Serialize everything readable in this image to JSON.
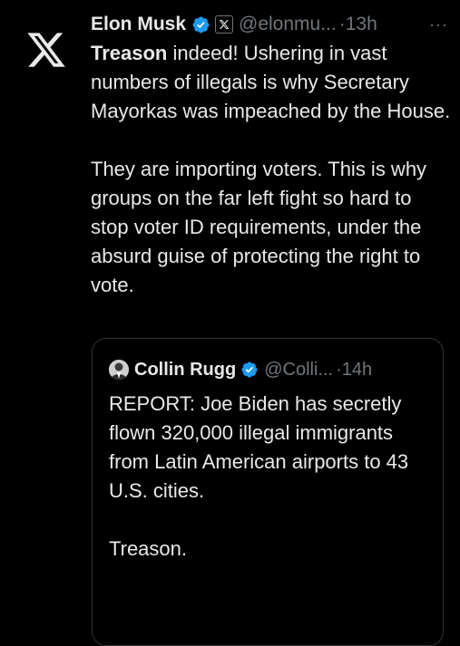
{
  "tweet": {
    "avatar_icon": "x-logo-icon",
    "author_name": "Elon Musk",
    "verified_icon": "verified-badge-icon",
    "affiliation_icon": "x-affiliate-icon",
    "handle": "@elonmu...",
    "separator": "·",
    "time": "13h",
    "more_icon": "more-options-icon",
    "more_label": "···",
    "text": {
      "bold_word": "Treason",
      "p1_rest": " indeed! Ushering in vast numbers of illegals is why Secretary Mayorkas was impeached by the House.",
      "p2": "They are importing voters. This is why groups on the far left fight so hard to stop voter ID requirements, under the absurd guise of protecting the right to vote."
    }
  },
  "quote": {
    "avatar_icon": "profile-photo-icon",
    "author_name": "Collin Rugg",
    "verified_icon": "verified-badge-icon",
    "handle": "@Colli...",
    "separator": "·",
    "time": "14h",
    "p1": "REPORT: Joe Biden has secretly flown 320,000 illegal immigrants from Latin American airports to 43 U.S. cities.",
    "p2": "Treason."
  },
  "colors": {
    "background": "#000000",
    "text_primary": "#e7e9ea",
    "text_secondary": "#71767b",
    "verified_blue": "#1d9bf0",
    "border": "#2f3336"
  }
}
